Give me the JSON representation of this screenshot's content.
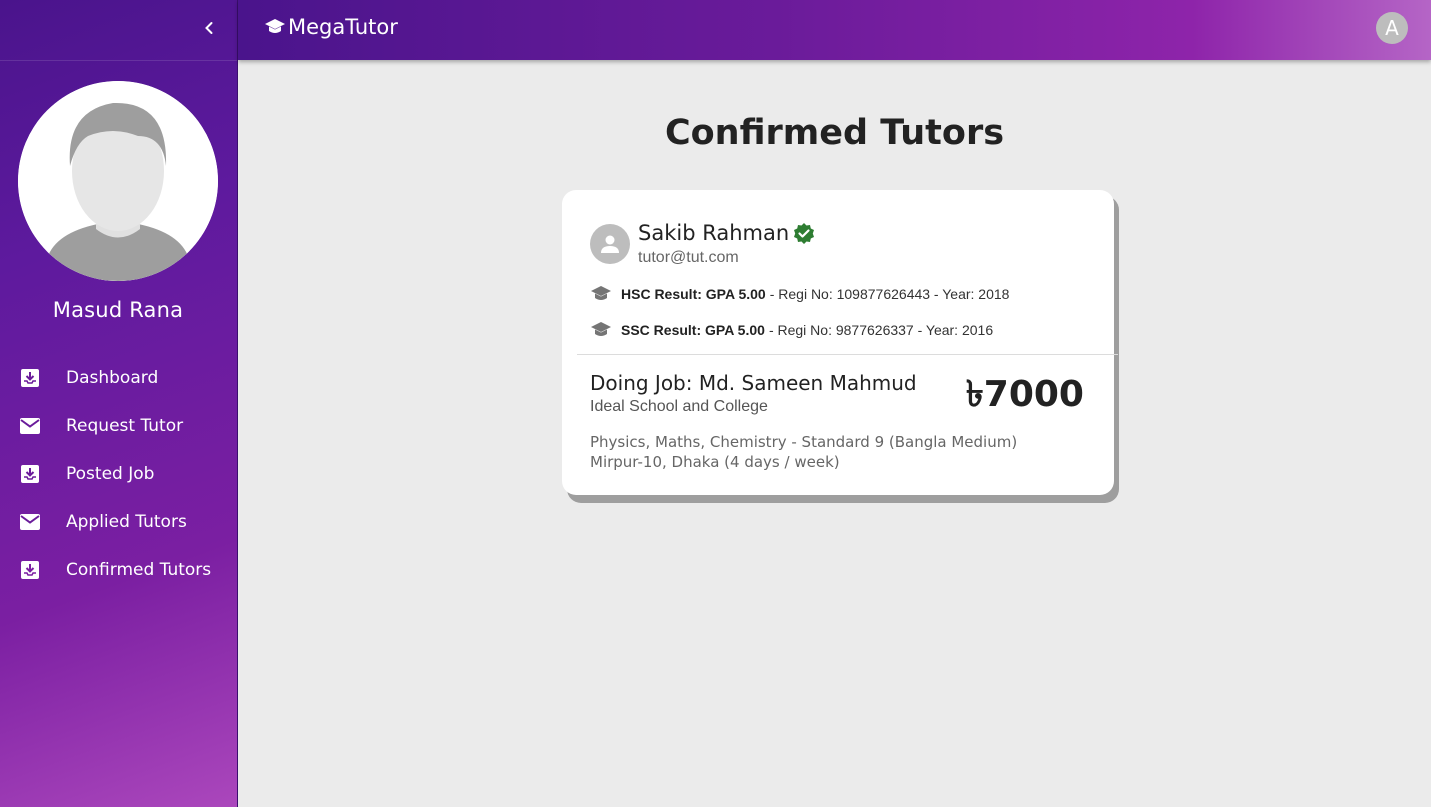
{
  "app": {
    "brand": "MegaTutor",
    "account_initial": "A"
  },
  "sidebar": {
    "user_name": "Masud Rana",
    "items": [
      {
        "label": "Dashboard",
        "icon": "inbox-icon"
      },
      {
        "label": "Request Tutor",
        "icon": "mail-icon"
      },
      {
        "label": "Posted Job",
        "icon": "inbox-icon"
      },
      {
        "label": "Applied Tutors",
        "icon": "mail-icon"
      },
      {
        "label": "Confirmed Tutors",
        "icon": "inbox-icon"
      }
    ]
  },
  "main": {
    "title": "Confirmed Tutors",
    "card": {
      "tutor_name": "Sakib Rahman",
      "tutor_email": "tutor@tut.com",
      "hsc": {
        "bold": "HSC Result: GPA 5.00",
        "rest": "- Regi No: 109877626443 - Year: 2018"
      },
      "ssc": {
        "bold": "SSC Result: GPA 5.00",
        "rest": "- Regi No: 9877626337 - Year: 2016"
      },
      "job_title": "Doing Job: Md. Sameen Mahmud",
      "institution": "Ideal School and College",
      "salary": "৳7000",
      "subjects": "Physics, Maths, Chemistry - Standard 9 (Bangla Medium)",
      "location": "Mirpur-10, Dhaka (4 days / week)"
    }
  },
  "colors": {
    "primary": "#6a1b9a",
    "verified": "#2e7d32"
  }
}
